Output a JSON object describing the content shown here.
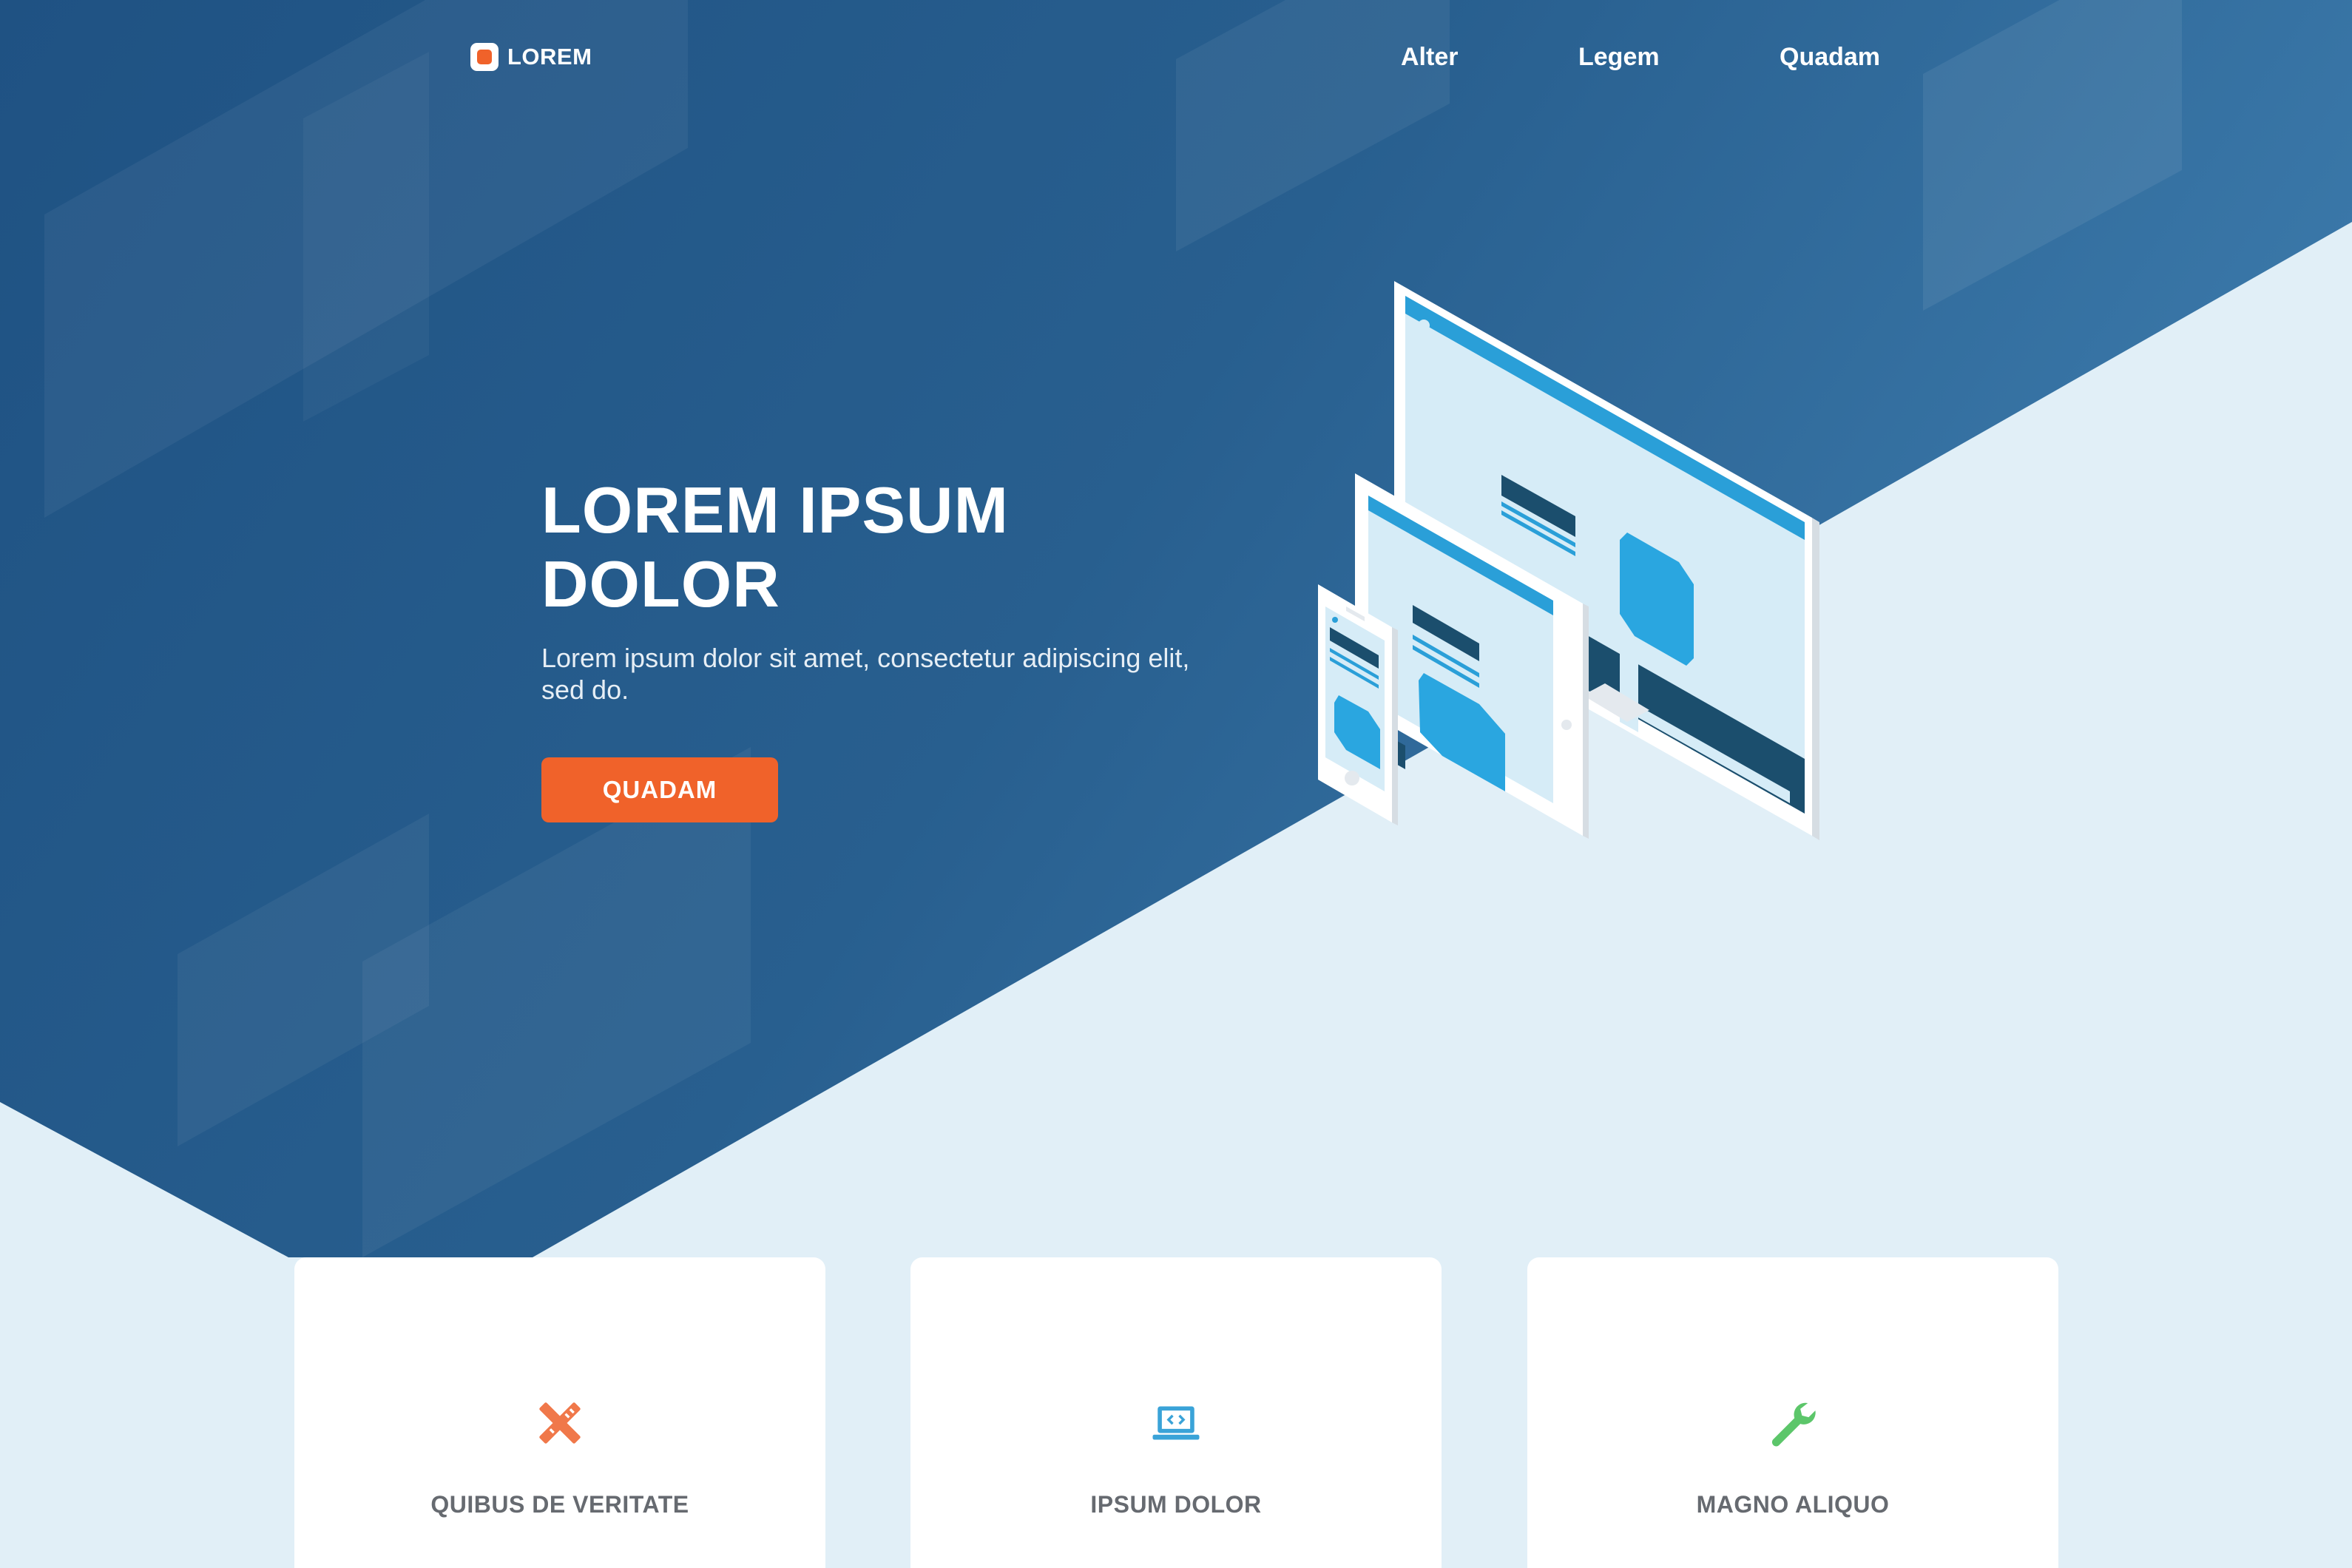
{
  "header": {
    "logo_text": "LOREM",
    "nav": [
      {
        "label": "Alter"
      },
      {
        "label": "Legem"
      },
      {
        "label": "Quadam"
      }
    ]
  },
  "hero": {
    "title_line1": "LOREM IPSUM",
    "title_line2": "DOLOR",
    "subtitle": "Lorem ipsum dolor sit amet, consectetur adipiscing elit, sed do.",
    "cta_label": "QUADAM"
  },
  "features": [
    {
      "icon": "pencil-ruler-icon",
      "title": "QUIBUS DE VERITATE",
      "color": "#f0784a"
    },
    {
      "icon": "laptop-code-icon",
      "title": "IPSUM DOLOR",
      "color": "#3aa3d8"
    },
    {
      "icon": "wrench-icon",
      "title": "MAGNO ALIQUO",
      "color": "#5cc66a"
    }
  ],
  "colors": {
    "hero_blue": "#23598a",
    "page_bg": "#e1eff7",
    "accent": "#f0622a"
  }
}
